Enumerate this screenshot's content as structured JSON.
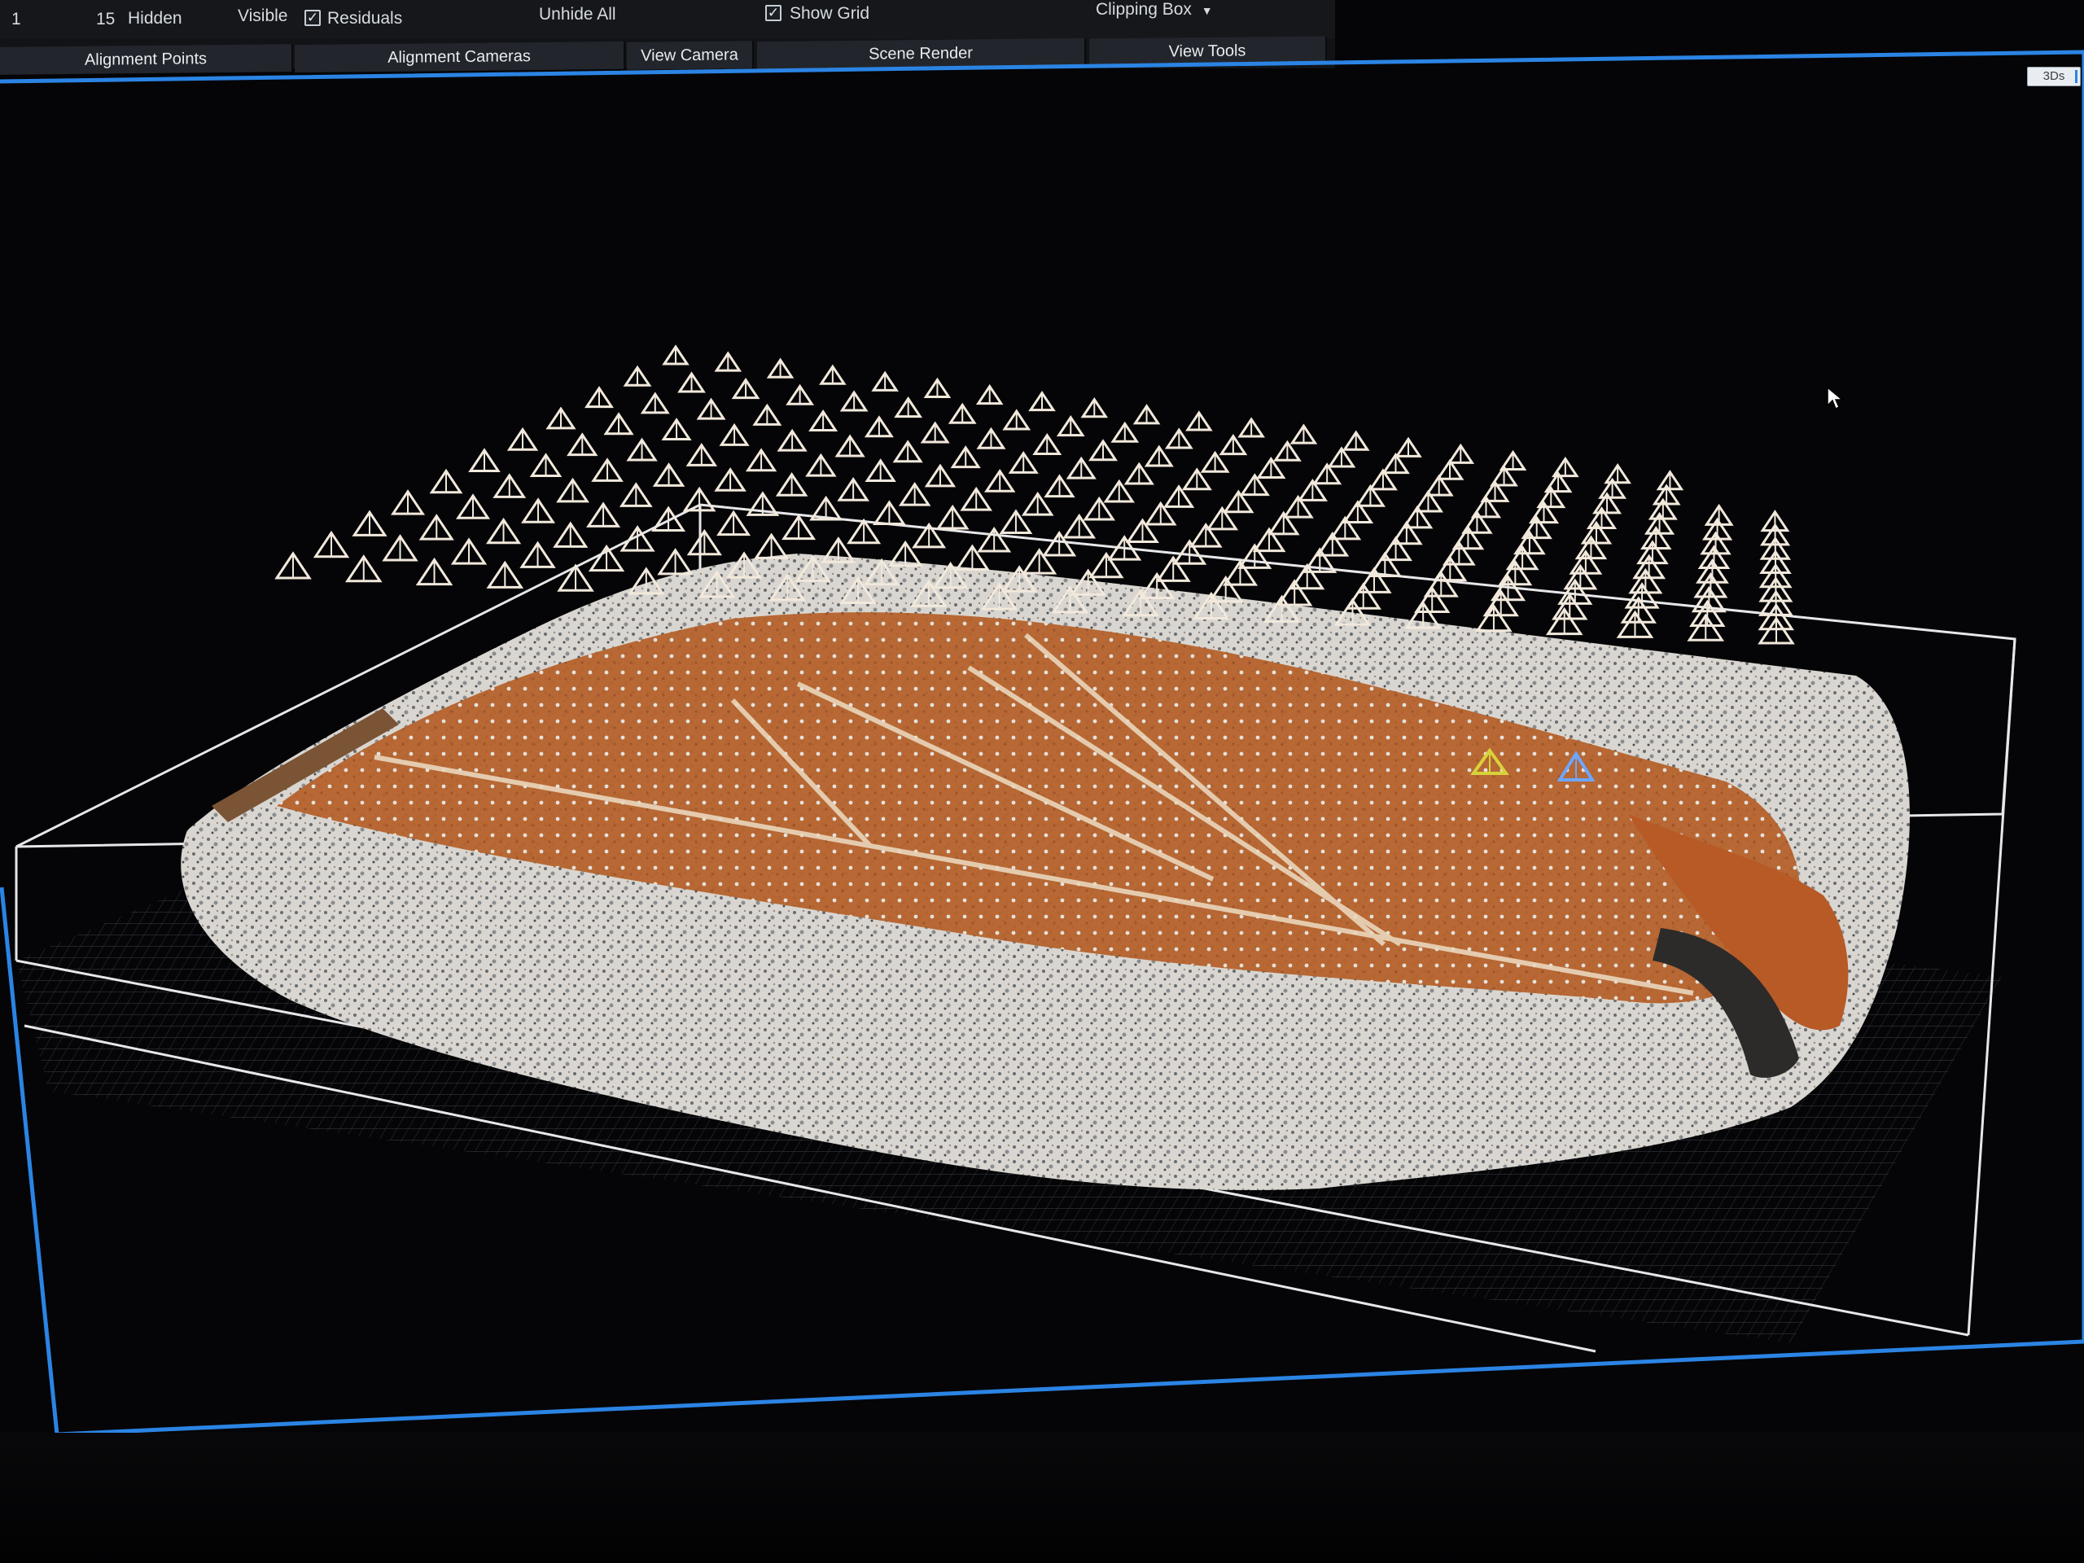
{
  "toolbar": {
    "count_a": "1",
    "count_b": "15",
    "hidden_label": "Hidden",
    "visible_label": "Visible",
    "residuals_label": "Residuals",
    "residuals_checked": true,
    "unhide_all_label": "Unhide All",
    "show_grid_label": "Show Grid",
    "show_grid_checked": true,
    "clipping_box_label": "Clipping Box",
    "clipping_box_icon": "caret-down-icon"
  },
  "tabs": [
    {
      "label": "Alignment Points"
    },
    {
      "label": "Alignment Cameras"
    },
    {
      "label": "View Camera"
    },
    {
      "label": "Scene Render"
    },
    {
      "label": "View Tools"
    }
  ],
  "viewport": {
    "scale_badge": "3Ds",
    "accent_color": "#2b84e4",
    "ground_color": "#b8672f",
    "snow_color": "#e8e6e2",
    "camera_color": "#f2e9dc",
    "selected_camera_colors": [
      "#d8d23a",
      "#6ea6ff"
    ]
  }
}
